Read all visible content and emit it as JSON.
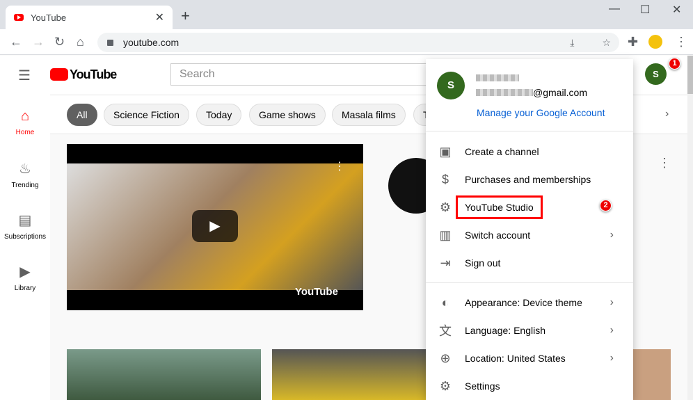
{
  "browser": {
    "tab_title": "YouTube",
    "url": "youtube.com"
  },
  "header": {
    "logo": "YouTube",
    "search_placeholder": "Search",
    "avatar_letter": "S"
  },
  "sidebar": {
    "items": [
      {
        "label": "Home",
        "icon": "home-icon"
      },
      {
        "label": "Trending",
        "icon": "flame-icon"
      },
      {
        "label": "Subscriptions",
        "icon": "subscriptions-icon"
      },
      {
        "label": "Library",
        "icon": "library-icon"
      }
    ]
  },
  "chips": [
    "All",
    "Science Fiction",
    "Today",
    "Game shows",
    "Masala films",
    "T"
  ],
  "menu": {
    "avatar_letter": "S",
    "email_suffix": "@gmail.com",
    "manage": "Manage your Google Account",
    "items": [
      {
        "label": "Create a channel",
        "icon": "person-icon"
      },
      {
        "label": "Purchases and memberships",
        "icon": "dollar-icon"
      },
      {
        "label": "YouTube Studio",
        "icon": "gear-icon"
      },
      {
        "label": "Switch account",
        "icon": "switch-account-icon"
      },
      {
        "label": "Sign out",
        "icon": "sign-out-icon"
      },
      {
        "label": "Appearance: Device theme",
        "icon": "theme-icon"
      },
      {
        "label": "Language: English",
        "icon": "translate-icon"
      },
      {
        "label": "Location: United States",
        "icon": "globe-icon"
      },
      {
        "label": "Settings",
        "icon": "gear-icon"
      }
    ]
  },
  "video": {
    "watermark": "YouTube"
  },
  "annotations": [
    "1",
    "2"
  ],
  "colors": {
    "accent": "#ff0000",
    "link": "#065fd4",
    "avatar": "#33691e",
    "highlight": "#ff0000"
  }
}
